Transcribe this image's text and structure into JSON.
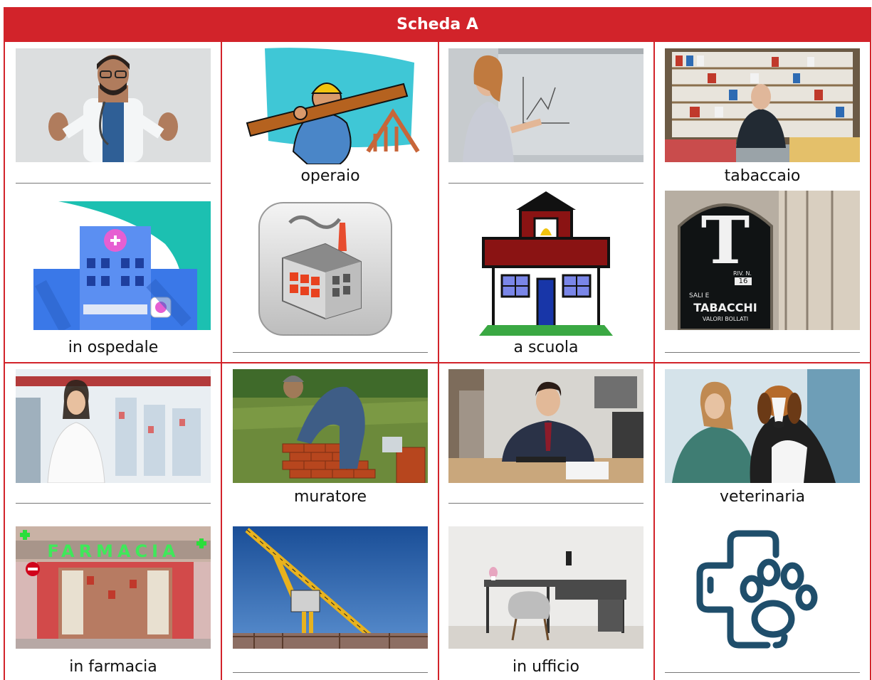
{
  "sheet": {
    "title": "Scheda A"
  },
  "cells": {
    "doctor": {
      "caption": ""
    },
    "operaio": {
      "caption": "operaio"
    },
    "teacher": {
      "caption": ""
    },
    "tabaccaio": {
      "caption": "tabaccaio"
    },
    "ospedale": {
      "caption": "in ospedale"
    },
    "factory": {
      "caption": ""
    },
    "scuola": {
      "caption": "a scuola"
    },
    "tabacchi_sign": {
      "caption": "",
      "sign_letter": "T",
      "sign_riv": "RIV. N.",
      "sign_num": "16",
      "sign_sali": "SALI E",
      "sign_tabacchi": "TABACCHI",
      "sign_valori": "VALORI BOLLATI"
    },
    "pharmacist": {
      "caption": ""
    },
    "muratore": {
      "caption": "muratore"
    },
    "office_worker": {
      "caption": ""
    },
    "veterinaria": {
      "caption": "veterinaria"
    },
    "farmacia": {
      "caption": "in farmacia",
      "sign": "FARMACIA"
    },
    "crane": {
      "caption": ""
    },
    "ufficio": {
      "caption": "in ufficio"
    },
    "vet_icon": {
      "caption": ""
    }
  },
  "colors": {
    "accent": "#d2232a",
    "vet_icon": "#1f4e6b"
  }
}
